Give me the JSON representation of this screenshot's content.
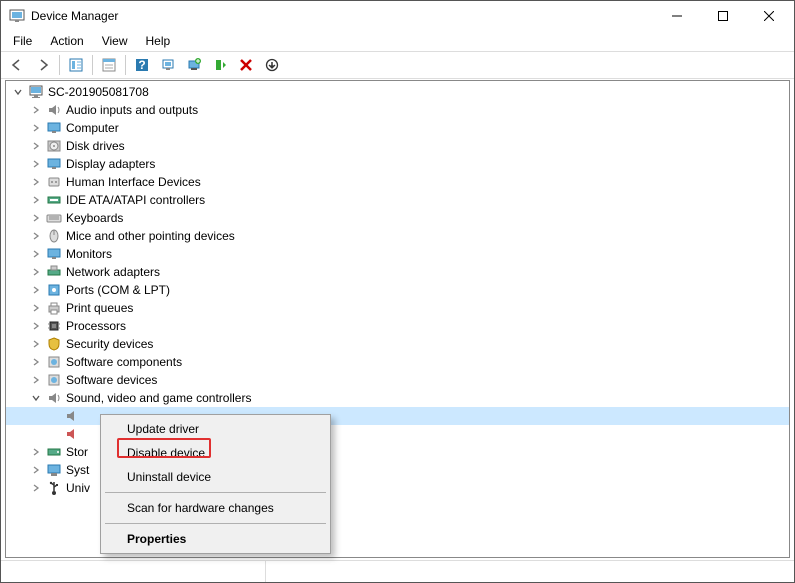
{
  "window": {
    "title": "Device Manager"
  },
  "menu": {
    "file": "File",
    "action": "Action",
    "view": "View",
    "help": "Help"
  },
  "tree": {
    "root": "SC-201905081708",
    "items": [
      {
        "label": "Audio inputs and outputs",
        "icon": "speaker"
      },
      {
        "label": "Computer",
        "icon": "monitor"
      },
      {
        "label": "Disk drives",
        "icon": "disk"
      },
      {
        "label": "Display adapters",
        "icon": "monitor"
      },
      {
        "label": "Human Interface Devices",
        "icon": "hid"
      },
      {
        "label": "IDE ATA/ATAPI controllers",
        "icon": "ide"
      },
      {
        "label": "Keyboards",
        "icon": "keyboard"
      },
      {
        "label": "Mice and other pointing devices",
        "icon": "mouse"
      },
      {
        "label": "Monitors",
        "icon": "monitor"
      },
      {
        "label": "Network adapters",
        "icon": "network"
      },
      {
        "label": "Ports (COM & LPT)",
        "icon": "port"
      },
      {
        "label": "Print queues",
        "icon": "printer"
      },
      {
        "label": "Processors",
        "icon": "cpu"
      },
      {
        "label": "Security devices",
        "icon": "security"
      },
      {
        "label": "Software components",
        "icon": "component"
      },
      {
        "label": "Software devices",
        "icon": "component"
      }
    ],
    "sound_category": "Sound, video and game controllers",
    "partials": [
      {
        "label": "Stor",
        "icon": "storage"
      },
      {
        "label": "Syst",
        "icon": "system"
      },
      {
        "label": "Univ",
        "icon": "usb"
      }
    ]
  },
  "context_menu": {
    "update": "Update driver",
    "disable": "Disable device",
    "uninstall": "Uninstall device",
    "scan": "Scan for hardware changes",
    "properties": "Properties"
  }
}
